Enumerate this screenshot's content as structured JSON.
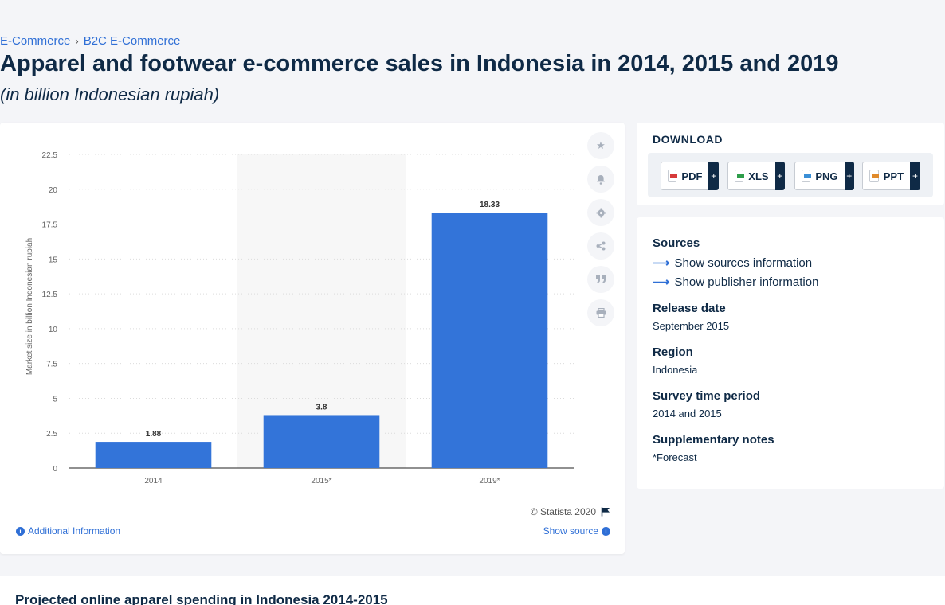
{
  "breadcrumb": [
    "E-Commerce",
    "B2C E-Commerce"
  ],
  "title": "Apparel and footwear e-commerce sales in Indonesia in 2014, 2015 and 2019",
  "subtitle": "(in billion Indonesian rupiah)",
  "chart_data": {
    "type": "bar",
    "categories": [
      "2014",
      "2015*",
      "2019*"
    ],
    "values": [
      1.88,
      3.8,
      18.33
    ],
    "data_labels": [
      "1.88",
      "3.8",
      "18.33"
    ],
    "ylabel": "Market size in billion Indonesian rupiah",
    "xlabel": "",
    "ylim": [
      0,
      22.5
    ],
    "yticks": [
      "0",
      "2.5",
      "5",
      "7.5",
      "10",
      "12.5",
      "15",
      "17.5",
      "20",
      "22.5"
    ],
    "grid": true,
    "bar_color": "#3374d9",
    "highlighted_category": "2015*"
  },
  "chart_footer": {
    "copyright": "© Statista 2020",
    "additional_info": "Additional Information",
    "show_source": "Show source"
  },
  "toolbar_icons": [
    "star-icon",
    "bell-icon",
    "gear-icon",
    "share-icon",
    "quote-icon",
    "print-icon"
  ],
  "download": {
    "title": "DOWNLOAD",
    "formats": [
      "PDF",
      "XLS",
      "PNG",
      "PPT"
    ],
    "plus": "+"
  },
  "meta": {
    "sources_head": "Sources",
    "show_sources": "Show sources information",
    "show_publisher": "Show publisher information",
    "release_head": "Release date",
    "release_val": "September 2015",
    "region_head": "Region",
    "region_val": "Indonesia",
    "survey_head": "Survey time period",
    "survey_val": "2014 and 2015",
    "notes_head": "Supplementary notes",
    "notes_val": "*Forecast"
  },
  "related": {
    "title": "Projected online apparel spending in Indonesia 2014-2015"
  }
}
